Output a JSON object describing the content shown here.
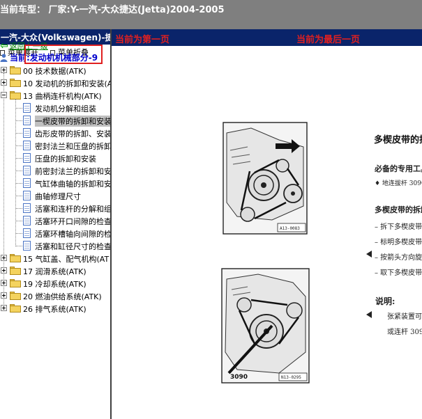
{
  "window": {
    "title": "当前车型： 厂家:Y-一汽-大众捷达(Jetta)2004-2005"
  },
  "left_panel": {
    "header": "一汽-大众(Volkswagen)-捷达(",
    "toolbar": {
      "expand_label": "菜单展开",
      "collapse_label": "菜单折叠"
    },
    "back_link": "返回上一级",
    "current_label": "当前:发动机机械部分-9",
    "tree": [
      {
        "label": "00 技术数据(ATK)",
        "type": "folder",
        "expanded": false
      },
      {
        "label": "10 发动机的拆卸和安装(A",
        "type": "folder",
        "expanded": false
      },
      {
        "label": "13 曲柄连杆机构(ATK)",
        "type": "folder",
        "expanded": true
      },
      {
        "label": "发动机分解和组装",
        "type": "doc"
      },
      {
        "label": "一楔皮带的拆卸和安装",
        "type": "doc",
        "selected": true
      },
      {
        "label": "齿形皮带的拆卸、安装",
        "type": "doc"
      },
      {
        "label": "密封法兰和压盘的拆卸",
        "type": "doc"
      },
      {
        "label": "压盘的拆卸和安装",
        "type": "doc"
      },
      {
        "label": "前密封法兰的拆卸和安",
        "type": "doc"
      },
      {
        "label": "气缸体曲轴的拆卸和安",
        "type": "doc"
      },
      {
        "label": "曲轴修理尺寸",
        "type": "doc"
      },
      {
        "label": "活塞和连杆的分解和组",
        "type": "doc"
      },
      {
        "label": "活塞环开口间隙的检查",
        "type": "doc"
      },
      {
        "label": "活塞环槽轴向间隙的检",
        "type": "doc"
      },
      {
        "label": "活塞和缸径尺寸的检查",
        "type": "doc"
      },
      {
        "label": "15 气缸盖、配气机构(AT",
        "type": "folder",
        "expanded": false
      },
      {
        "label": "17 润滑系统(ATK)",
        "type": "folder",
        "expanded": false
      },
      {
        "label": "19 冷却系统(ATK)",
        "type": "folder",
        "expanded": false
      },
      {
        "label": "20 燃油供给系统(ATK)",
        "type": "folder",
        "expanded": false
      },
      {
        "label": "26 排气系统(ATK)",
        "type": "folder",
        "expanded": false
      }
    ]
  },
  "right_panel": {
    "first_page_label": "当前为第一页",
    "last_page_label": "当前为最后一页",
    "document": {
      "heading": "多楔皮带的拆",
      "tools_heading": "必备的专用工具",
      "tool_item": "♦ 地连拔杆 3090",
      "removal_heading": "多楔皮带的拆卸",
      "steps": [
        "– 拆下多楔皮带",
        "– 标明多楔皮带",
        "– 按箭头方向旋",
        "– 取下多楔皮带"
      ],
      "note_heading": "说明:",
      "note_text_1": "张紧装置可以",
      "note_text_2": "或连杆 3090",
      "figure1_code": "A13-0083",
      "figure2_code": "N13-0295",
      "figure2_tool": "3090"
    }
  },
  "colors": {
    "titlebar_bg": "#7f7f7f",
    "panel_header_bg": "#0a246a",
    "page_indicator": "#e02020",
    "current_text": "#0000cc",
    "back_link": "#008000",
    "highlight_box": "#e02020"
  }
}
